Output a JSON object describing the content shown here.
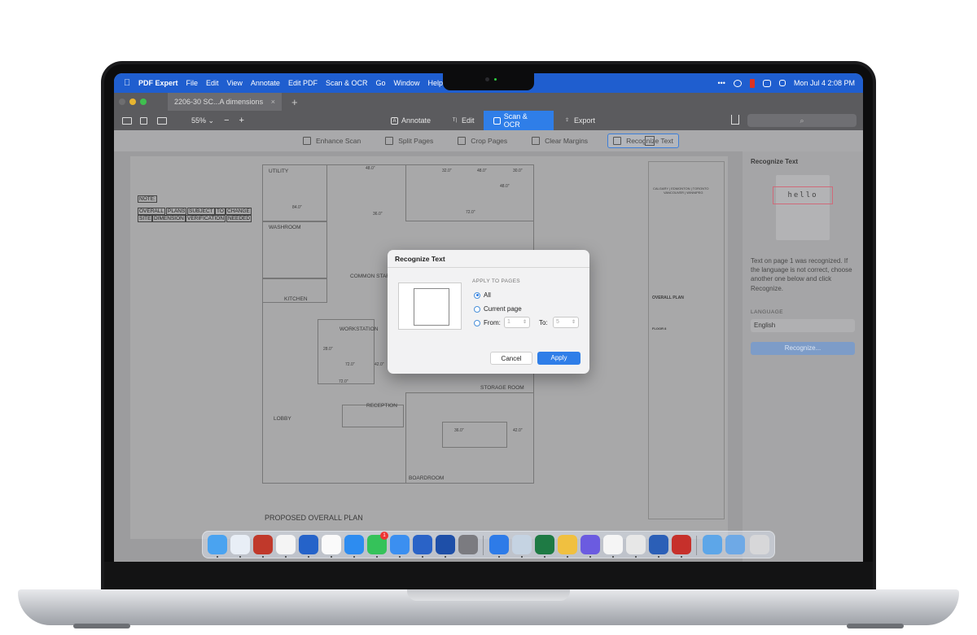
{
  "menubar": {
    "app_name": "PDF Expert",
    "items": [
      "File",
      "Edit",
      "View",
      "Annotate",
      "Edit PDF",
      "Scan & OCR",
      "Go",
      "Window",
      "Help"
    ],
    "clock": "Mon Jul 4  2:08 PM",
    "more": "•••"
  },
  "tab": {
    "title": "2206-30 SC...A dimensions",
    "close": "×",
    "new": "+"
  },
  "toolbar": {
    "zoom": "55% ⌄",
    "zoom_out": "−",
    "zoom_in": "+",
    "modes": [
      "Annotate",
      "Edit",
      "Scan & OCR",
      "Export"
    ],
    "active_mode": "Scan & OCR",
    "search_placeholder": "⌕"
  },
  "scan_tools": [
    "Enhance Scan",
    "Split Pages",
    "Crop Pages",
    "Clear Margins",
    "Recognize Text"
  ],
  "active_tool": "Recognize Text",
  "floorplan": {
    "note_title": "NOTE:",
    "note_row1": [
      "OVERALL",
      "PLANS",
      "SUBJECT",
      "TO",
      "CHANGE"
    ],
    "note_row2": [
      "SITE",
      "DIMENSION",
      "VERIFICATION",
      "NEEDED"
    ],
    "rooms": {
      "utility": "UTILITY",
      "washroom": "WASHROOM",
      "common": "COMMON STAF",
      "kitchen": "KITCHEN",
      "workstation": "WORKSTATION",
      "reception": "RECEPTION",
      "lobby": "LOBBY",
      "storage": "STORAGE ROOM",
      "boardroom": "BOARDROOM"
    },
    "dims": {
      "d1": "48.0\"",
      "d2": "32.0\"",
      "d3": "48.0\"",
      "d4": "30.0\"",
      "d5": "48.0\"",
      "d6": "84.0\"",
      "d7": "36.0\"",
      "d8": "72.0\"",
      "d9": "28.0\"",
      "d10": "72.0\"",
      "d11": "42.0\"",
      "d12": "72.0\"",
      "d13": "36.0\"",
      "d14": "42.0\""
    },
    "plan_title": "PROPOSED OVERALL PLAN",
    "tb_cities": "CALGARY | EDMONTON | TORONTO",
    "tb_cities2": "VANCOUVER | WINNIPEG",
    "tb_project": "OVERALL PLAN",
    "tb_floor": "FLOOR 8"
  },
  "side_panel": {
    "title": "Recognize Text",
    "sample_word": "hello",
    "info": "Text on page 1 was recognized. If the language is not correct, choose another one below and click Recognize.",
    "language_label": "LANGUAGE",
    "language": "English",
    "button": "Recognize..."
  },
  "dialog": {
    "title": "Recognize Text",
    "section": "APPLY TO PAGES",
    "options": [
      "All",
      "Current page",
      "From:"
    ],
    "selected": "All",
    "from_value": "1",
    "to_label": "To:",
    "to_value": "5",
    "cancel": "Cancel",
    "apply": "Apply",
    "badge": "1"
  },
  "dock_icons": [
    "finder-icon",
    "onepassword-icon",
    "parallels-icon",
    "calendar-icon",
    "tasks-icon",
    "notion-icon",
    "safari-icon",
    "messages-icon",
    "mail-icon",
    "stats-icon",
    "pdf-expert-icon",
    "settings-icon",
    "windows-icon",
    "scanner-icon",
    "excel-icon",
    "sketch-icon",
    "hand-icon",
    "pages-icon",
    "chrome-icon",
    "word-icon",
    "acrobat-icon",
    "downloads-icon",
    "folder-icon",
    "trash-icon"
  ],
  "colors": {
    "accent": "#2f7ee8",
    "menubar": "#1f5ecf"
  }
}
